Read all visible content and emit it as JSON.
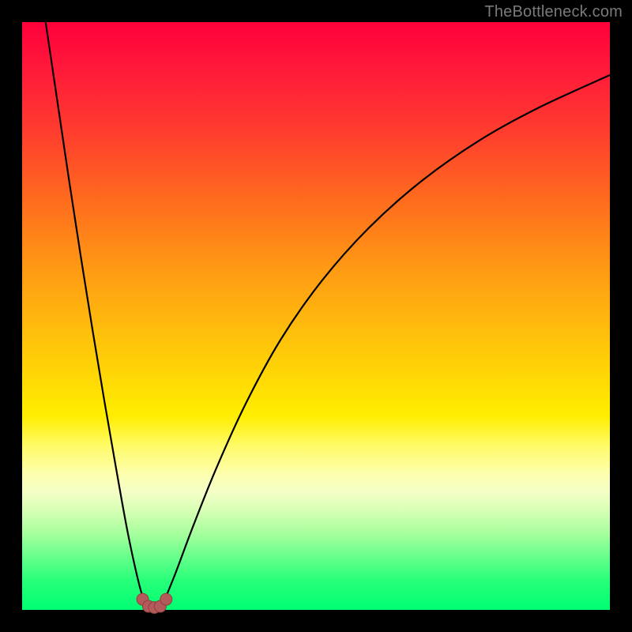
{
  "attribution": "TheBottleneck.com",
  "colors": {
    "page_bg": "#000000",
    "curve": "#000000",
    "marker_fill": "#b35a5a",
    "marker_stroke": "#8f3e3e",
    "attribution_text": "#7a7a7a"
  },
  "chart_data": {
    "type": "line",
    "title": "",
    "xlabel": "",
    "ylabel": "",
    "xlim": [
      0,
      1
    ],
    "ylim": [
      0,
      1
    ],
    "grid": false,
    "series": [
      {
        "name": "left-branch",
        "x": [
          0.04,
          0.06,
          0.08,
          0.1,
          0.12,
          0.14,
          0.16,
          0.18,
          0.2,
          0.21,
          0.215
        ],
        "y": [
          1.0,
          0.865,
          0.73,
          0.6,
          0.475,
          0.355,
          0.24,
          0.13,
          0.04,
          0.012,
          0.005
        ]
      },
      {
        "name": "right-branch",
        "x": [
          0.235,
          0.24,
          0.26,
          0.29,
          0.33,
          0.38,
          0.44,
          0.51,
          0.59,
          0.68,
          0.78,
          0.88,
          1.0
        ],
        "y": [
          0.005,
          0.012,
          0.06,
          0.14,
          0.24,
          0.35,
          0.46,
          0.56,
          0.65,
          0.73,
          0.8,
          0.855,
          0.91
        ]
      },
      {
        "name": "valley-markers",
        "type_override": "scatter",
        "x": [
          0.205,
          0.215,
          0.225,
          0.235,
          0.245
        ],
        "y": [
          0.018,
          0.006,
          0.004,
          0.006,
          0.018
        ]
      }
    ]
  }
}
